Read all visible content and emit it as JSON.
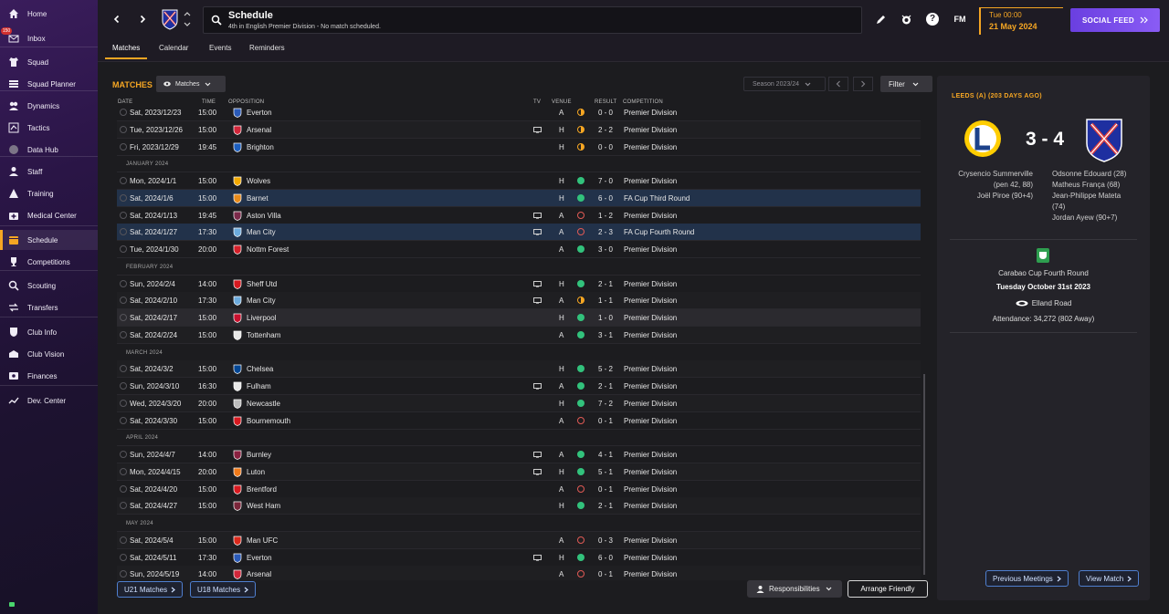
{
  "sidebar": {
    "items": [
      {
        "label": "Home",
        "icon": "home-icon"
      },
      {
        "label": "Inbox",
        "icon": "inbox-icon",
        "badge": "150"
      },
      {
        "label": "Squad",
        "icon": "shirt-icon"
      },
      {
        "label": "Squad Planner",
        "icon": "planner-icon"
      },
      {
        "label": "Dynamics",
        "icon": "dynamics-icon"
      },
      {
        "label": "Tactics",
        "icon": "tactics-icon"
      },
      {
        "label": "Data Hub",
        "icon": "data-hub-icon"
      },
      {
        "label": "Staff",
        "icon": "staff-icon"
      },
      {
        "label": "Training",
        "icon": "training-icon"
      },
      {
        "label": "Medical Center",
        "icon": "medical-icon"
      },
      {
        "label": "Schedule",
        "icon": "calendar-icon"
      },
      {
        "label": "Competitions",
        "icon": "trophy-icon"
      },
      {
        "label": "Scouting",
        "icon": "scouting-icon"
      },
      {
        "label": "Transfers",
        "icon": "transfers-icon"
      },
      {
        "label": "Club Info",
        "icon": "shield-icon"
      },
      {
        "label": "Club Vision",
        "icon": "vision-icon"
      },
      {
        "label": "Finances",
        "icon": "finances-icon"
      },
      {
        "label": "Dev. Center",
        "icon": "dev-center-icon"
      }
    ],
    "active": "Schedule"
  },
  "header": {
    "title": "Schedule",
    "subtitle": "4th in English Premier Division - No match scheduled.",
    "fm_logo": "FM",
    "help": "?",
    "time": "Tue 00:00",
    "date": "21 May 2024",
    "social_feed": "SOCIAL FEED"
  },
  "subtabs": [
    "Matches",
    "Calendar",
    "Events",
    "Reminders"
  ],
  "matches": {
    "section_label": "MATCHES",
    "view_dropdown": "Matches",
    "season": "Season 2023/24",
    "filter": "Filter",
    "columns": {
      "date": "DATE",
      "time": "TIME",
      "opposition": "OPPOSITION",
      "tv": "TV",
      "venue": "VENUE",
      "result": "RESULT",
      "competition": "COMPETITION"
    },
    "rows": [
      {
        "kind": "match",
        "date": "Sat, 2023/12/23",
        "time": "15:00",
        "opp": "Everton",
        "tv": false,
        "venue": "A",
        "res": "d",
        "score": "0 - 0",
        "comp": "Premier Division",
        "crest": "#2a5ab8"
      },
      {
        "kind": "match",
        "date": "Tue, 2023/12/26",
        "time": "15:00",
        "opp": "Arsenal",
        "tv": true,
        "venue": "H",
        "res": "d",
        "score": "2 - 2",
        "comp": "Premier Division",
        "crest": "#d1263a"
      },
      {
        "kind": "match",
        "date": "Fri, 2023/12/29",
        "time": "19:45",
        "opp": "Brighton",
        "tv": false,
        "venue": "H",
        "res": "d",
        "score": "0 - 0",
        "comp": "Premier Division",
        "crest": "#1d5fbf"
      },
      {
        "kind": "month",
        "label": "JANUARY 2024"
      },
      {
        "kind": "match",
        "date": "Mon, 2024/1/1",
        "time": "15:00",
        "opp": "Wolves",
        "tv": false,
        "venue": "H",
        "res": "w",
        "score": "7 - 0",
        "comp": "Premier Division",
        "crest": "#f2a900"
      },
      {
        "kind": "match",
        "date": "Sat, 2024/1/6",
        "time": "15:00",
        "opp": "Barnet",
        "tv": false,
        "venue": "H",
        "res": "w",
        "score": "6 - 0",
        "comp": "FA Cup Third Round",
        "crest": "#e88a1a",
        "style": "sel"
      },
      {
        "kind": "match",
        "date": "Sat, 2024/1/13",
        "time": "19:45",
        "opp": "Aston Villa",
        "tv": true,
        "venue": "A",
        "res": "l",
        "score": "1 - 2",
        "comp": "Premier Division",
        "crest": "#7b2a4a"
      },
      {
        "kind": "match",
        "date": "Sat, 2024/1/27",
        "time": "17:30",
        "opp": "Man City",
        "tv": true,
        "venue": "A",
        "res": "l",
        "score": "2 - 3",
        "comp": "FA Cup Fourth Round",
        "crest": "#6cabdd",
        "style": "sel"
      },
      {
        "kind": "match",
        "date": "Tue, 2024/1/30",
        "time": "20:00",
        "opp": "Nottm Forest",
        "tv": false,
        "venue": "A",
        "res": "w",
        "score": "3 - 0",
        "comp": "Premier Division",
        "crest": "#d4202a"
      },
      {
        "kind": "month",
        "label": "FEBRUARY 2024"
      },
      {
        "kind": "match",
        "date": "Sun, 2024/2/4",
        "time": "14:00",
        "opp": "Sheff Utd",
        "tv": true,
        "venue": "H",
        "res": "w",
        "score": "2 - 1",
        "comp": "Premier Division",
        "crest": "#d71920"
      },
      {
        "kind": "match",
        "date": "Sat, 2024/2/10",
        "time": "17:30",
        "opp": "Man City",
        "tv": true,
        "venue": "A",
        "res": "d",
        "score": "1 - 1",
        "comp": "Premier Division",
        "crest": "#6cabdd"
      },
      {
        "kind": "match",
        "date": "Sat, 2024/2/17",
        "time": "15:00",
        "opp": "Liverpool",
        "tv": false,
        "venue": "H",
        "res": "w",
        "score": "1 - 0",
        "comp": "Premier Division",
        "crest": "#c8102e",
        "style": "hl"
      },
      {
        "kind": "match",
        "date": "Sat, 2024/2/24",
        "time": "15:00",
        "opp": "Tottenham",
        "tv": false,
        "venue": "A",
        "res": "w",
        "score": "3 - 1",
        "comp": "Premier Division",
        "crest": "#e8e8e8"
      },
      {
        "kind": "month",
        "label": "MARCH 2024"
      },
      {
        "kind": "match",
        "date": "Sat, 2024/3/2",
        "time": "15:00",
        "opp": "Chelsea",
        "tv": false,
        "venue": "H",
        "res": "w",
        "score": "5 - 2",
        "comp": "Premier Division",
        "crest": "#034694"
      },
      {
        "kind": "match",
        "date": "Sun, 2024/3/10",
        "time": "16:30",
        "opp": "Fulham",
        "tv": true,
        "venue": "A",
        "res": "w",
        "score": "2 - 1",
        "comp": "Premier Division",
        "crest": "#e8e8e8"
      },
      {
        "kind": "match",
        "date": "Wed, 2024/3/20",
        "time": "20:00",
        "opp": "Newcastle",
        "tv": false,
        "venue": "H",
        "res": "w",
        "score": "7 - 2",
        "comp": "Premier Division",
        "crest": "#bdbdbd"
      },
      {
        "kind": "match",
        "date": "Sat, 2024/3/30",
        "time": "15:00",
        "opp": "Bournemouth",
        "tv": false,
        "venue": "A",
        "res": "l",
        "score": "0 - 1",
        "comp": "Premier Division",
        "crest": "#d71920"
      },
      {
        "kind": "month",
        "label": "APRIL 2024"
      },
      {
        "kind": "match",
        "date": "Sun, 2024/4/7",
        "time": "14:00",
        "opp": "Burnley",
        "tv": true,
        "venue": "A",
        "res": "w",
        "score": "4 - 1",
        "comp": "Premier Division",
        "crest": "#8a2140"
      },
      {
        "kind": "match",
        "date": "Mon, 2024/4/15",
        "time": "20:00",
        "opp": "Luton",
        "tv": true,
        "venue": "H",
        "res": "w",
        "score": "5 - 1",
        "comp": "Premier Division",
        "crest": "#f07a1a"
      },
      {
        "kind": "match",
        "date": "Sat, 2024/4/20",
        "time": "15:00",
        "opp": "Brentford",
        "tv": false,
        "venue": "A",
        "res": "l",
        "score": "0 - 1",
        "comp": "Premier Division",
        "crest": "#d71920"
      },
      {
        "kind": "match",
        "date": "Sat, 2024/4/27",
        "time": "15:00",
        "opp": "West Ham",
        "tv": false,
        "venue": "H",
        "res": "w",
        "score": "2 - 1",
        "comp": "Premier Division",
        "crest": "#7a263a"
      },
      {
        "kind": "month",
        "label": "MAY 2024"
      },
      {
        "kind": "match",
        "date": "Sat, 2024/5/4",
        "time": "15:00",
        "opp": "Man UFC",
        "tv": false,
        "venue": "A",
        "res": "l",
        "score": "0 - 3",
        "comp": "Premier Division",
        "crest": "#da291c"
      },
      {
        "kind": "match",
        "date": "Sat, 2024/5/11",
        "time": "17:30",
        "opp": "Everton",
        "tv": true,
        "venue": "H",
        "res": "w",
        "score": "6 - 0",
        "comp": "Premier Division",
        "crest": "#2a5ab8"
      },
      {
        "kind": "match",
        "date": "Sun, 2024/5/19",
        "time": "14:00",
        "opp": "Arsenal",
        "tv": false,
        "venue": "A",
        "res": "l",
        "score": "0 - 1",
        "comp": "Premier Division",
        "crest": "#d1263a"
      }
    ],
    "u21_button": "U21 Matches",
    "u18_button": "U18 Matches",
    "responsibilities": "Responsibilities",
    "arrange_friendly": "Arrange Friendly"
  },
  "detail": {
    "title": "LEEDS (A) (203 DAYS AGO)",
    "score": "3 - 4",
    "home_scorers": [
      "Crysencio Summerville",
      "(pen 42, 88)",
      "Joël Piroe (90+4)"
    ],
    "away_scorers": [
      "Odsonne Edouard (28)",
      "Matheus França (68)",
      "Jean-Philippe Mateta",
      "(74)",
      "Jordan Ayew (90+7)"
    ],
    "competition": "Carabao Cup Fourth Round",
    "match_date": "Tuesday October 31st 2023",
    "venue": "Elland Road",
    "attendance": "Attendance: 34,272 (802 Away)",
    "previous_meetings": "Previous Meetings",
    "view_match": "View Match"
  },
  "colors": {
    "accent": "#f5a623",
    "win": "#32c27c",
    "loss": "#e05a55",
    "draw": "#f5a623",
    "social": "#7a4ef0"
  }
}
